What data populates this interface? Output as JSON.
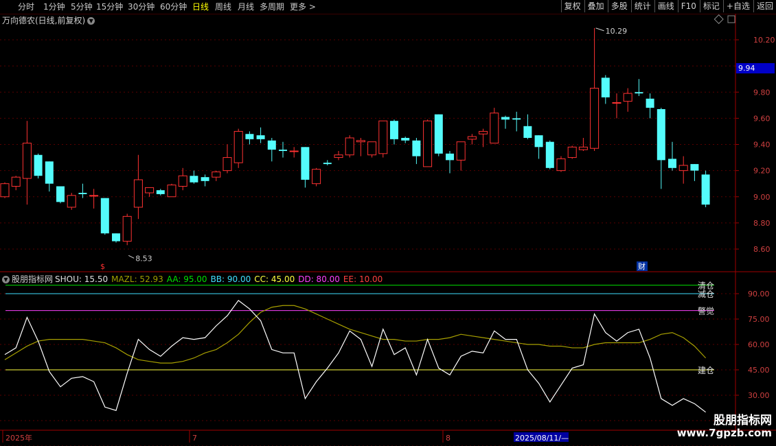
{
  "toolbar": {
    "left": [
      {
        "label": "分时"
      },
      {
        "label": "1分钟"
      },
      {
        "label": "5分钟"
      },
      {
        "label": "15分钟"
      },
      {
        "label": "30分钟"
      },
      {
        "label": "60分钟"
      },
      {
        "label": "日线",
        "active": true
      },
      {
        "label": "周线"
      },
      {
        "label": "月线"
      },
      {
        "label": "多周期"
      },
      {
        "label": "更多 >"
      }
    ],
    "right": [
      {
        "label": "复权"
      },
      {
        "label": "叠加"
      },
      {
        "label": "多股"
      },
      {
        "label": "统计"
      },
      {
        "label": "画线"
      },
      {
        "label": "F10"
      },
      {
        "label": "标记"
      },
      {
        "label": "+自选"
      },
      {
        "label": "返回"
      }
    ]
  },
  "stock": {
    "title": "万向德农(日线,前复权)",
    "current_price": "9.94"
  },
  "annotations": {
    "high": "10.29",
    "low": "8.53",
    "flag_low": "$",
    "flag_fin": "财"
  },
  "price_axis": {
    "labels": [
      "10.20",
      "10.00",
      "9.80",
      "9.60",
      "9.40",
      "9.20",
      "9.00",
      "8.80",
      "8.60"
    ],
    "values": [
      10.2,
      10.0,
      9.8,
      9.6,
      9.4,
      9.2,
      9.0,
      8.8,
      8.6
    ]
  },
  "indicator": {
    "name": "股朋指标网",
    "values": [
      {
        "label": "SHOU: 15.50",
        "color": "#e0e0e0"
      },
      {
        "label": "MAZL: 52.93",
        "color": "#a0a000"
      },
      {
        "label": "AA: 95.00",
        "color": "#00e000"
      },
      {
        "label": "BB: 90.00",
        "color": "#40e0ff"
      },
      {
        "label": "CC: 45.00",
        "color": "#ffff40"
      },
      {
        "label": "DD: 80.00",
        "color": "#ff40ff"
      },
      {
        "label": "EE: 10.00",
        "color": "#ff4040"
      }
    ],
    "axis_labels": [
      "90.00",
      "75.00",
      "60.00",
      "45.00",
      "30.00"
    ],
    "axis_values": [
      90,
      75,
      60,
      45,
      30
    ],
    "level_labels": [
      {
        "text": "清仓",
        "value": 95,
        "color": "#00e000"
      },
      {
        "text": "减仓",
        "value": 90,
        "color": "#40e0ff"
      },
      {
        "text": "警觉",
        "value": 80,
        "color": "#ff40ff"
      },
      {
        "text": "建仓",
        "value": 45,
        "color": "#ffff40"
      }
    ]
  },
  "date_axis": {
    "labels": [
      {
        "text": "2025年"
      },
      {
        "text": "7"
      },
      {
        "text": "8"
      },
      {
        "text": "2025/08/11/—",
        "highlight": true
      }
    ]
  },
  "chart_data": {
    "type": "candlestick",
    "candles": [
      [
        9.0,
        9.1,
        9.11,
        8.99
      ],
      [
        9.08,
        9.15,
        9.16,
        9.05
      ],
      [
        9.14,
        9.41,
        9.58,
        8.94
      ],
      [
        9.32,
        9.16,
        9.33,
        9.14
      ],
      [
        9.27,
        9.1,
        9.27,
        9.04
      ],
      [
        9.08,
        8.96,
        9.08,
        8.95
      ],
      [
        8.92,
        9.01,
        9.03,
        8.9
      ],
      [
        9.03,
        9.02,
        9.1,
        8.99
      ],
      [
        9.01,
        9.01,
        9.06,
        8.91
      ],
      [
        8.99,
        8.72,
        8.99,
        8.71
      ],
      [
        8.72,
        8.66,
        8.72,
        8.65
      ],
      [
        8.66,
        8.85,
        8.87,
        8.63
      ],
      [
        8.92,
        9.13,
        9.32,
        8.83
      ],
      [
        9.03,
        9.07,
        9.07,
        9.0
      ],
      [
        9.05,
        9.02,
        9.06,
        9.01
      ],
      [
        9.0,
        9.09,
        9.1,
        9.0
      ],
      [
        9.08,
        9.16,
        9.22,
        9.05
      ],
      [
        9.16,
        9.11,
        9.2,
        9.1
      ],
      [
        9.15,
        9.12,
        9.17,
        9.08
      ],
      [
        9.15,
        9.19,
        9.2,
        9.12
      ],
      [
        9.2,
        9.3,
        9.4,
        9.18
      ],
      [
        9.26,
        9.5,
        9.52,
        9.22
      ],
      [
        9.48,
        9.44,
        9.5,
        9.4
      ],
      [
        9.47,
        9.44,
        9.53,
        9.41
      ],
      [
        9.43,
        9.36,
        9.45,
        9.27
      ],
      [
        9.36,
        9.35,
        9.42,
        9.3
      ],
      [
        9.35,
        9.35,
        9.38,
        9.3
      ],
      [
        9.38,
        9.13,
        9.38,
        9.07
      ],
      [
        9.1,
        9.21,
        9.22,
        9.08
      ],
      [
        9.26,
        9.25,
        9.28,
        9.24
      ],
      [
        9.3,
        9.32,
        9.35,
        9.28
      ],
      [
        9.32,
        9.45,
        9.47,
        9.3
      ],
      [
        9.42,
        9.43,
        9.45,
        9.31
      ],
      [
        9.32,
        9.42,
        9.42,
        9.3
      ],
      [
        9.33,
        9.58,
        9.58,
        9.3
      ],
      [
        9.58,
        9.44,
        9.59,
        9.4
      ],
      [
        9.45,
        9.43,
        9.46,
        9.41
      ],
      [
        9.43,
        9.31,
        9.45,
        9.25
      ],
      [
        9.23,
        9.58,
        9.59,
        9.23
      ],
      [
        9.63,
        9.33,
        9.63,
        9.31
      ],
      [
        9.33,
        9.28,
        9.35,
        9.18
      ],
      [
        9.28,
        9.42,
        9.42,
        9.2
      ],
      [
        9.44,
        9.46,
        9.48,
        9.4
      ],
      [
        9.48,
        9.5,
        9.52,
        9.38
      ],
      [
        9.41,
        9.64,
        9.68,
        9.41
      ],
      [
        9.61,
        9.59,
        9.62,
        9.52
      ],
      [
        9.6,
        9.59,
        9.65,
        9.5
      ],
      [
        9.54,
        9.45,
        9.63,
        9.44
      ],
      [
        9.47,
        9.38,
        9.47,
        9.29
      ],
      [
        9.42,
        9.22,
        9.43,
        9.21
      ],
      [
        9.2,
        9.29,
        9.31,
        9.19
      ],
      [
        9.3,
        9.38,
        9.39,
        9.29
      ],
      [
        9.36,
        9.38,
        9.45,
        9.35
      ],
      [
        9.37,
        9.83,
        10.29,
        9.35
      ],
      [
        9.91,
        9.76,
        9.93,
        9.71
      ],
      [
        9.72,
        9.72,
        9.79,
        9.6
      ],
      [
        9.73,
        9.79,
        9.83,
        9.65
      ],
      [
        9.8,
        9.79,
        9.9,
        9.77
      ],
      [
        9.75,
        9.68,
        9.79,
        9.6
      ],
      [
        9.67,
        9.28,
        9.68,
        9.06
      ],
      [
        9.29,
        9.22,
        9.42,
        9.2
      ],
      [
        9.2,
        9.24,
        9.31,
        9.1
      ],
      [
        9.25,
        9.2,
        9.25,
        9.12
      ],
      [
        9.17,
        8.94,
        9.2,
        8.92
      ]
    ],
    "shou": [
      54,
      58,
      76,
      62,
      44,
      35,
      40,
      41,
      38,
      23,
      21,
      43,
      63,
      57,
      53,
      59,
      64,
      63,
      64,
      71,
      77,
      86,
      81,
      74,
      57,
      55,
      55,
      28,
      38,
      46,
      55,
      68,
      63,
      47,
      69,
      54,
      58,
      42,
      63,
      46,
      42,
      53,
      56,
      55,
      68,
      63,
      63,
      45,
      37,
      26,
      36,
      46,
      48,
      78,
      67,
      62,
      67,
      69,
      52,
      28,
      24,
      28,
      25,
      20
    ],
    "mazl": [
      51,
      55,
      59,
      62,
      63,
      63,
      63,
      63,
      62,
      61,
      58,
      54,
      51,
      50,
      49,
      49,
      50,
      52,
      55,
      57,
      61,
      66,
      73,
      79,
      82,
      83,
      83,
      81,
      78,
      75,
      72,
      69,
      67,
      65,
      63,
      63,
      62,
      62,
      63,
      63,
      64,
      66,
      65,
      64,
      63,
      62,
      61,
      60,
      60,
      59,
      59,
      58,
      58,
      60,
      61,
      61,
      61,
      61,
      63,
      66,
      67,
      64,
      59,
      52
    ],
    "levels": {
      "AA": 95,
      "BB": 90,
      "CC": 45,
      "DD": 80
    }
  }
}
